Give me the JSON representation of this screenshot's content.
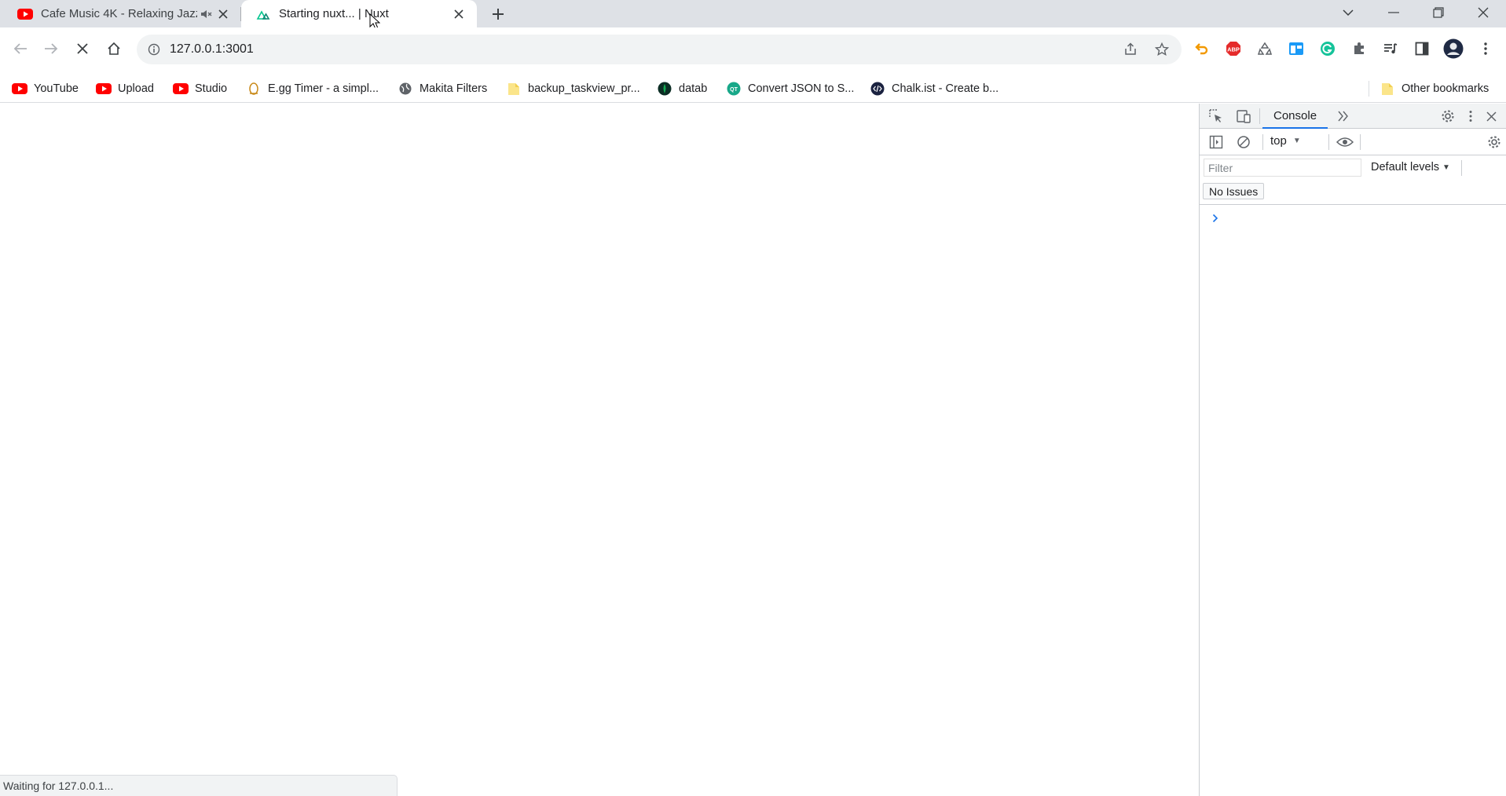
{
  "tabs": [
    {
      "title": "Cafe Music 4K - Relaxing Jazz",
      "favicon": "youtube-icon",
      "muted": true,
      "active": false
    },
    {
      "title": "Starting nuxt... | Nuxt",
      "favicon": "nuxt-icon",
      "active": true
    }
  ],
  "omnibox": {
    "url": "127.0.0.1:3001"
  },
  "bookmarks": [
    {
      "label": "YouTube",
      "icon": "youtube-icon"
    },
    {
      "label": "Upload",
      "icon": "youtube-icon"
    },
    {
      "label": "Studio",
      "icon": "youtube-icon"
    },
    {
      "label": "E.gg Timer - a simpl...",
      "icon": "egg-timer-icon"
    },
    {
      "label": "Makita Filters",
      "icon": "globe-icon"
    },
    {
      "label": "backup_taskview_pr...",
      "icon": "folder-icon"
    },
    {
      "label": "datab",
      "icon": "mongodb-icon"
    },
    {
      "label": "Convert JSON to S...",
      "icon": "qt-icon"
    },
    {
      "label": "Chalk.ist - Create b...",
      "icon": "code-icon"
    }
  ],
  "other_bookmarks": {
    "label": "Other bookmarks"
  },
  "devtools": {
    "active_tab": "Console",
    "context": "top",
    "filter_placeholder": "Filter",
    "levels": "Default levels",
    "issues": "No Issues"
  },
  "status": {
    "text": "Waiting for 127.0.0.1..."
  },
  "colors": {
    "tabstrip": "#dee1e6",
    "youtube_red": "#ff0000",
    "devtools_accent": "#1a73e8",
    "omnibox_bg": "#f1f3f4"
  }
}
